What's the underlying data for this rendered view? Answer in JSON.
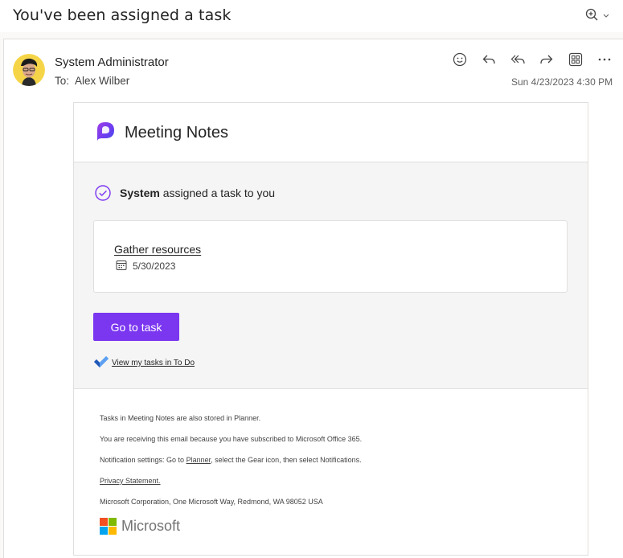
{
  "header": {
    "subject": "You've been assigned a task"
  },
  "message": {
    "sender": "System Administrator",
    "to_label": "To:",
    "to_name": "Alex Wilber",
    "date": "Sun 4/23/2023 4:30 PM",
    "actions": [
      "emoji-icon",
      "reply-icon",
      "reply-all-icon",
      "forward-icon",
      "apps-icon",
      "more-icon"
    ]
  },
  "email": {
    "brand": "Meeting Notes",
    "assigner": "System",
    "assign_text": " assigned a task to you",
    "task": {
      "title": "Gather resources",
      "due": "5/30/2023"
    },
    "button": "Go to task",
    "todo_link": "View my tasks in To Do",
    "footer": {
      "line1": "Tasks in Meeting Notes are also stored in Planner.",
      "line2": "You are receiving this email because you have subscribed to Microsoft Office 365.",
      "line3_pre": "Notification settings: Go to ",
      "line3_link": "Planner",
      "line3_post": ", select the Gear icon, then select Notifications.",
      "privacy": "Privacy Statement.",
      "address": "Microsoft Corporation, One Microsoft Way, Redmond, WA 98052 USA",
      "company": "Microsoft"
    }
  },
  "colors": {
    "accent": "#7b36f0",
    "link": "#242424"
  }
}
